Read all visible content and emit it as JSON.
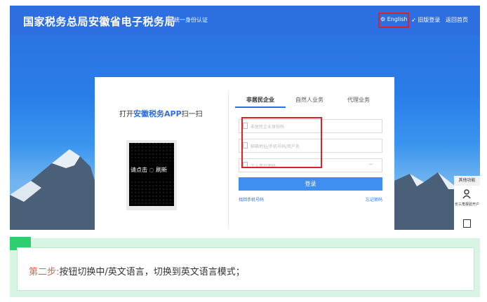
{
  "header": {
    "title": "国家税务总局安徽省电子税务局",
    "subtitle": "统一身份认证",
    "nav": {
      "english": "English",
      "old_login": "旧版登录",
      "home": "返回首页"
    }
  },
  "qr": {
    "prefix": "打开",
    "app_name": "安徽税务APP",
    "suffix": "扫一扫",
    "refresh": "请点击 ◌ 刷新"
  },
  "login": {
    "tabs": [
      "非居民企业",
      "自然人业务",
      "代理业务"
    ],
    "fields": [
      {
        "placeholder": "非居民企业身份码"
      },
      {
        "placeholder": "邮箱地址/手机号码/用户名"
      },
      {
        "placeholder": "个人用户密码"
      }
    ],
    "submit": "登录",
    "link_left": "找回手机号码",
    "link_right": "忘记密码"
  },
  "side_panel": {
    "title": "其他功能",
    "item": "长三角报验开户"
  },
  "caption": {
    "step": "第二步:",
    "text": "按钮切换中/英文语言，切换到英文语言模式；"
  },
  "colors": {
    "header_blue": "#2d6ee0",
    "annotation_red": "#d8232a",
    "caption_green": "#2fcf6f",
    "step_red": "#f05a4d"
  }
}
